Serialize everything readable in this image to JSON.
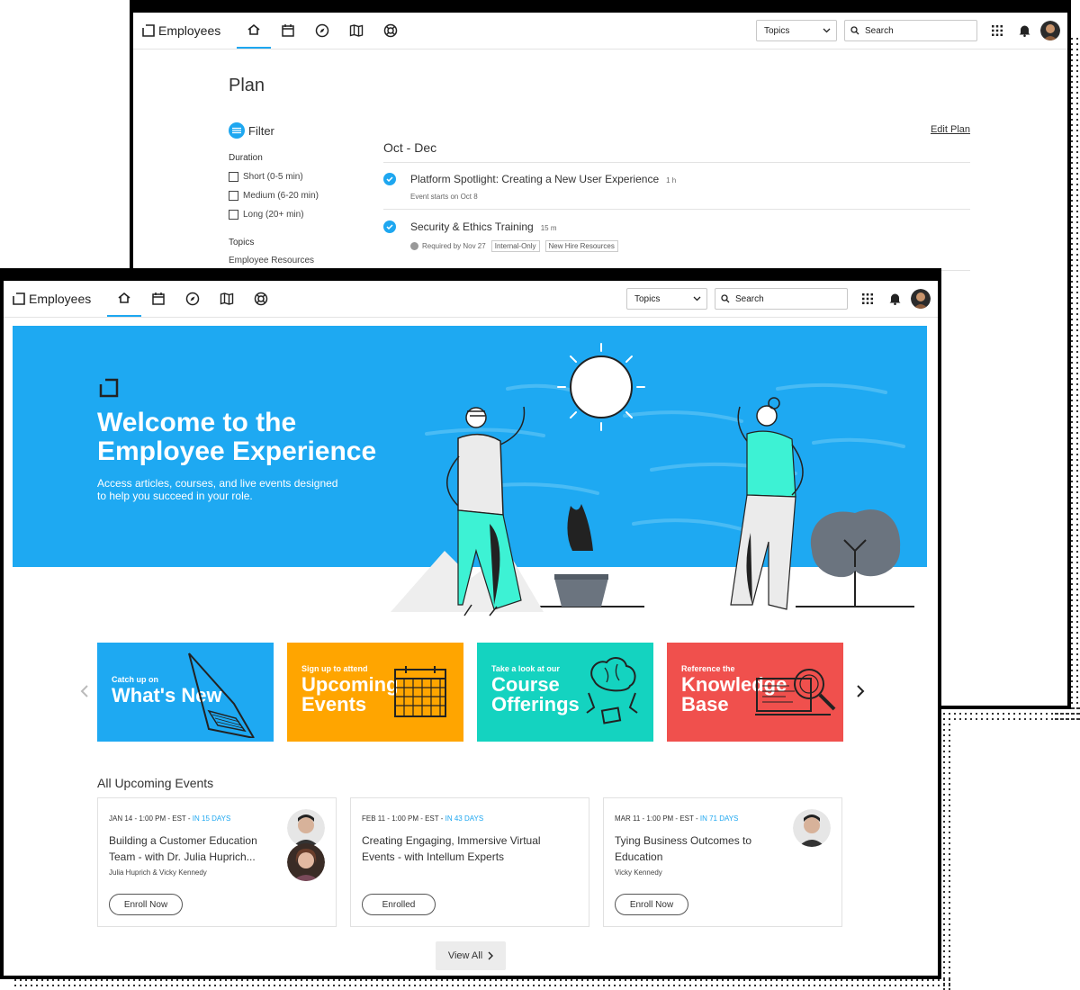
{
  "brand": "Employees",
  "header": {
    "topics_label": "Topics",
    "search_placeholder": "Search"
  },
  "plan": {
    "title": "Plan",
    "filter_label": "Filter",
    "duration_label": "Duration",
    "durations": [
      "Short (0-5 min)",
      "Medium (6-20 min)",
      "Long (20+ min)"
    ],
    "topics_label": "Topics",
    "topic_first": "Employee Resources",
    "period": "Oct - Dec",
    "edit_label": "Edit Plan",
    "items": [
      {
        "title": "Platform Spotlight: Creating a New User Experience",
        "duration": "1 h",
        "sub": "Event starts on Oct 8"
      },
      {
        "title": "Security & Ethics Training",
        "duration": "15 m",
        "sub": "Required by Nov 27",
        "tags": [
          "Internal-Only",
          "New Hire Resources"
        ]
      }
    ]
  },
  "hero": {
    "title": "Welcome to the Employee Experience",
    "subtitle": "Access articles, courses, and live events designed to help you succeed in your role."
  },
  "cards": [
    {
      "small": "Catch up on",
      "big": "What's New",
      "color": "#1ea9f2"
    },
    {
      "small": "Sign up to attend",
      "big1": "Upcoming",
      "big2": "Events",
      "color": "#ffa500"
    },
    {
      "small": "Take a look at our",
      "big1": "Course",
      "big2": "Offerings",
      "color": "#14d3c0"
    },
    {
      "small": "Reference the",
      "big1": "Knowledge",
      "big2": "Base",
      "color": "#f0504d"
    }
  ],
  "events": {
    "title": "All Upcoming Events",
    "items": [
      {
        "date": "JAN 14 - 1:00 PM - EST - ",
        "days": "IN 15 DAYS",
        "title": "Building a Customer Education Team - with Dr. Julia Huprich...",
        "host": "Julia Huprich & Vicky Kennedy",
        "button": "Enroll Now"
      },
      {
        "date": "FEB 11 - 1:00 PM - EST - ",
        "days": "IN 43 DAYS",
        "title": "Creating Engaging, Immersive Virtual Events - with Intellum Experts",
        "host": "",
        "button": "Enrolled"
      },
      {
        "date": "MAR 11 - 1:00 PM - EST - ",
        "days": "IN 71 DAYS",
        "title": "Tying Business Outcomes to Education",
        "host": "Vicky Kennedy",
        "button": "Enroll Now"
      }
    ],
    "view_all": "View All"
  }
}
